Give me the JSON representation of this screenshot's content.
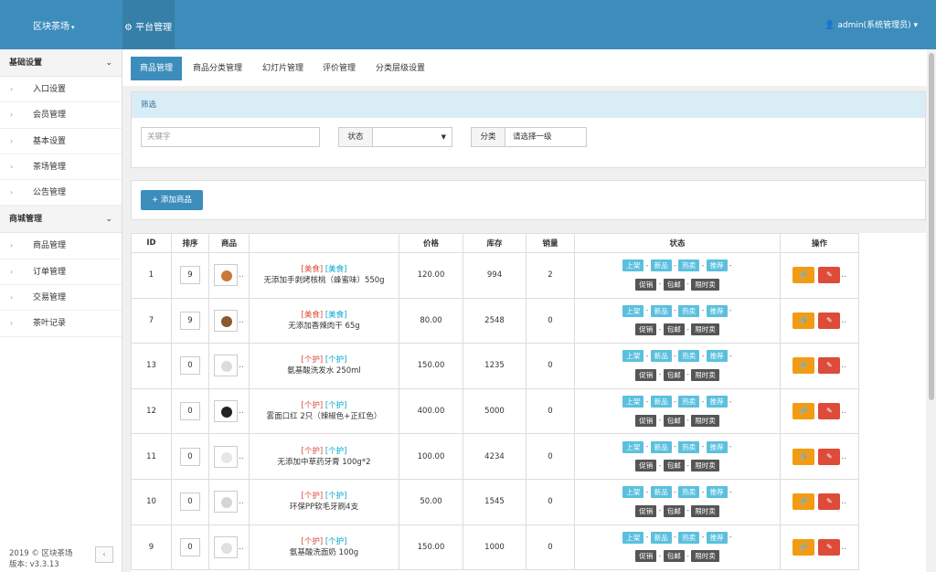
{
  "header": {
    "brand": "区块茶场",
    "platform": "平台管理",
    "user": "admin(系统管理员)"
  },
  "sidebar": {
    "group1": "基础设置",
    "group1_items": [
      "入口设置",
      "会员管理",
      "基本设置",
      "茶场管理",
      "公告管理"
    ],
    "group2": "商城管理",
    "group2_items": [
      "商品管理",
      "订单管理",
      "交易管理",
      "茶叶记录"
    ],
    "footer_year": "2019 © 区块茶场",
    "footer_version": "版本: v3.3.13"
  },
  "tabs": [
    "商品管理",
    "商品分类管理",
    "幻灯片管理",
    "评价管理",
    "分类层级设置"
  ],
  "filter": {
    "heading": "筛选",
    "keyword_placeholder": "关键字",
    "status_label": "状态",
    "status_value": "",
    "category_label": "分类",
    "category_value": "请选择一级"
  },
  "add_button": "添加商品",
  "table": {
    "columns": [
      "ID",
      "排序",
      "商品",
      "",
      "价格",
      "库存",
      "销量",
      "状态",
      "操作"
    ],
    "status_badges_row1": [
      "上架",
      "新品",
      "热卖",
      "推荐"
    ],
    "status_badges_row2": [
      "促销",
      "包邮",
      "限时卖"
    ],
    "rows": [
      {
        "id": "1",
        "sort": "9",
        "cat1": "[美食]",
        "cat2": "[美食]",
        "name": "无添加手剥烤核桃（蜂蜜味）550g",
        "price": "120.00",
        "stock": "994",
        "sales": "2"
      },
      {
        "id": "7",
        "sort": "9",
        "cat1": "[美食]",
        "cat2": "[美食]",
        "name": "无添加香辣肉干 65g",
        "price": "80.00",
        "stock": "2548",
        "sales": "0"
      },
      {
        "id": "13",
        "sort": "0",
        "cat1": "[个护]",
        "cat2": "[个护]",
        "name": "氨基酸洗发水 250ml",
        "price": "150.00",
        "stock": "1235",
        "sales": "0"
      },
      {
        "id": "12",
        "sort": "0",
        "cat1": "[个护]",
        "cat2": "[个护]",
        "name": "雾面口红 2只（辣椒色+正红色）",
        "price": "400.00",
        "stock": "5000",
        "sales": "0"
      },
      {
        "id": "11",
        "sort": "0",
        "cat1": "[个护]",
        "cat2": "[个护]",
        "name": "无添加中草药牙膏 100g*2",
        "price": "100.00",
        "stock": "4234",
        "sales": "0"
      },
      {
        "id": "10",
        "sort": "0",
        "cat1": "[个护]",
        "cat2": "[个护]",
        "name": "环保PP软毛牙刷4支",
        "price": "50.00",
        "stock": "1545",
        "sales": "0"
      },
      {
        "id": "9",
        "sort": "0",
        "cat1": "[个护]",
        "cat2": "[个护]",
        "name": "氨基酸洗面奶 100g",
        "price": "150.00",
        "stock": "1000",
        "sales": "0"
      }
    ]
  },
  "colors": {
    "header_bg": "#3c8dbc",
    "badge_blue": "#5bc0de",
    "badge_dark": "#555555",
    "btn_link": "#f39c12",
    "btn_edit": "#dd4b39"
  }
}
